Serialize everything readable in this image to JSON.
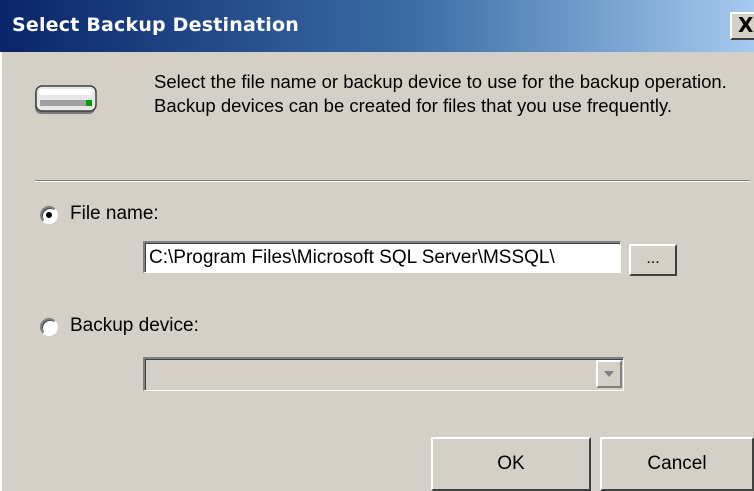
{
  "window": {
    "title": "Select Backup Destination",
    "close_label": "X"
  },
  "header": {
    "icon": "backup-device-icon",
    "description": "Select the file name or backup device to use for the backup operation.  Backup devices can be created for files that you use frequently."
  },
  "options": {
    "file_name": {
      "label": "File name:",
      "selected": true,
      "value": "C:\\Program Files\\Microsoft SQL Server\\MSSQL\\",
      "browse_label": "..."
    },
    "backup_device": {
      "label": "Backup device:",
      "selected": false,
      "value": ""
    }
  },
  "buttons": {
    "ok": "OK",
    "cancel": "Cancel"
  },
  "colors": {
    "dialog_bg": "#d4d0c8",
    "titlebar_start": "#0a246a",
    "titlebar_end": "#a6caf0"
  }
}
